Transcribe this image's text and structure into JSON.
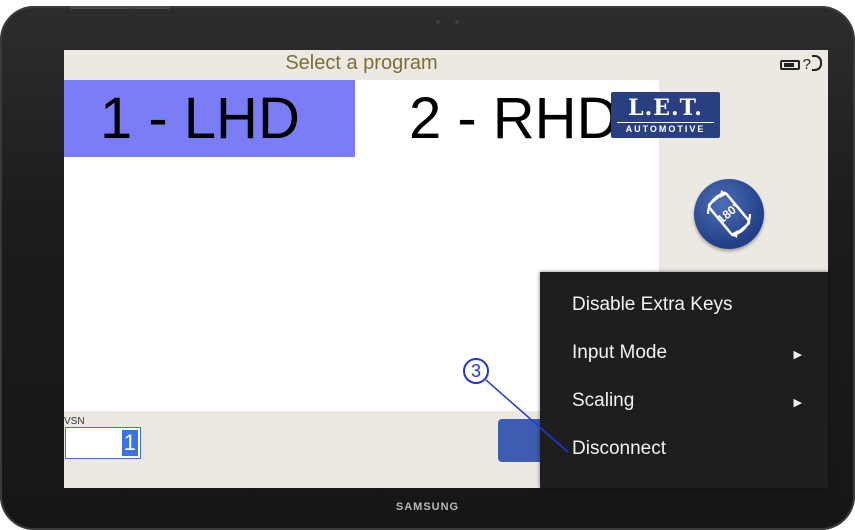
{
  "header": {
    "title": "Select a program",
    "help_label": "?"
  },
  "programs": [
    {
      "label": "1 - LHD",
      "selected": true
    },
    {
      "label": "2 - RHD",
      "selected": false
    }
  ],
  "logo": {
    "top": "L.E.T.",
    "bottom": "AUTOMOTIVE"
  },
  "rotate_button": {
    "label": "180°"
  },
  "vsn": {
    "label": "VSN",
    "value": "1"
  },
  "context_menu": {
    "items": [
      {
        "label": "Disable Extra Keys",
        "submenu": false
      },
      {
        "label": "Input Mode",
        "submenu": true
      },
      {
        "label": "Scaling",
        "submenu": true
      },
      {
        "label": "Disconnect",
        "submenu": false
      }
    ]
  },
  "callout": {
    "number": "3"
  },
  "device": {
    "brand": "SAMSUNG"
  },
  "colors": {
    "selected_program": "#7b7df7",
    "logo_bg": "#283f82",
    "menu_bg": "#1e1e1e",
    "callout": "#1f37d8",
    "title_text": "#7a7033"
  }
}
